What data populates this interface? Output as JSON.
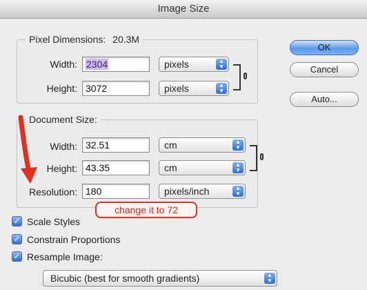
{
  "window": {
    "title": "Image Size"
  },
  "buttons": {
    "ok": "OK",
    "cancel": "Cancel",
    "auto": "Auto..."
  },
  "pixel_dimensions": {
    "label": "Pixel Dimensions:",
    "value": "20.3M",
    "width": {
      "label": "Width:",
      "value": "2304",
      "unit": "pixels"
    },
    "height": {
      "label": "Height:",
      "value": "3072",
      "unit": "pixels"
    }
  },
  "document_size": {
    "label": "Document Size:",
    "width": {
      "label": "Width:",
      "value": "32.51",
      "unit": "cm"
    },
    "height": {
      "label": "Height:",
      "value": "43.35",
      "unit": "cm"
    },
    "resolution": {
      "label": "Resolution:",
      "value": "180",
      "unit": "pixels/inch"
    }
  },
  "options": {
    "scale_styles": {
      "label": "Scale Styles",
      "checked": true
    },
    "constrain_proportions": {
      "label": "Constrain Proportions",
      "checked": true
    },
    "resample_image": {
      "label": "Resample Image:",
      "checked": true
    },
    "resample_method": "Bicubic (best for smooth gradients)"
  },
  "annotation": {
    "text": "change it to 72",
    "color": "#e0301e"
  },
  "icons": {
    "checkmark": "checkmark-icon",
    "stepper": "popup-stepper-icon",
    "link": "chain-link-icon",
    "arrow": "red-arrow-icon"
  }
}
